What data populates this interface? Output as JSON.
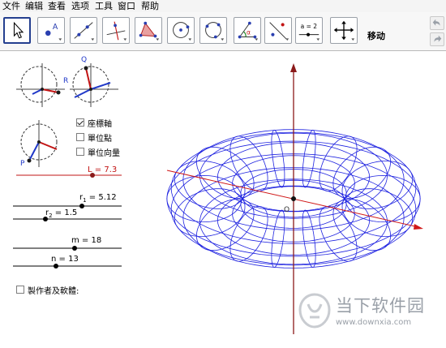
{
  "menubar": {
    "items": [
      "文件",
      "编辑",
      "查看",
      "选项",
      "工具",
      "窗口",
      "帮助"
    ]
  },
  "toolbar": {
    "mode_label": "移动",
    "slider_tool_text": "a = 2",
    "angle_tool_text": "α",
    "tools": [
      "move-tool",
      "point-tool",
      "line-tool",
      "perpendicular-tool",
      "polygon-tool",
      "circle-tool",
      "conic-tool",
      "angle-tool",
      "reflect-tool",
      "slider-tool",
      "move-view-tool"
    ]
  },
  "points": {
    "q": "Q",
    "r": "R",
    "p": "P",
    "origin": "O"
  },
  "checkboxes": [
    {
      "label": "座標軸",
      "checked": true
    },
    {
      "label": "單位點",
      "checked": false
    },
    {
      "label": "單位向量",
      "checked": false
    }
  ],
  "sliders": {
    "l": {
      "name": "L",
      "value": "7.3"
    },
    "r1": {
      "name": "r",
      "sub": "1",
      "value": "5.12"
    },
    "r2": {
      "name": "r",
      "sub": "2",
      "value": "1.5"
    },
    "m": {
      "name": "m",
      "value": "18"
    },
    "n": {
      "name": "n",
      "value": "13"
    }
  },
  "credits_checkbox": {
    "label": "製作者及軟體:",
    "checked": false
  },
  "watermark": {
    "text": "当下软件园",
    "url": "www.downxia.com"
  },
  "colors": {
    "torus": "#1f23e0",
    "axis_red": "#d01818",
    "axis_z": "#8b1a1a",
    "point": "#1a1a1a",
    "vector_red": "#c21414",
    "vector_blue": "#2038c8"
  }
}
